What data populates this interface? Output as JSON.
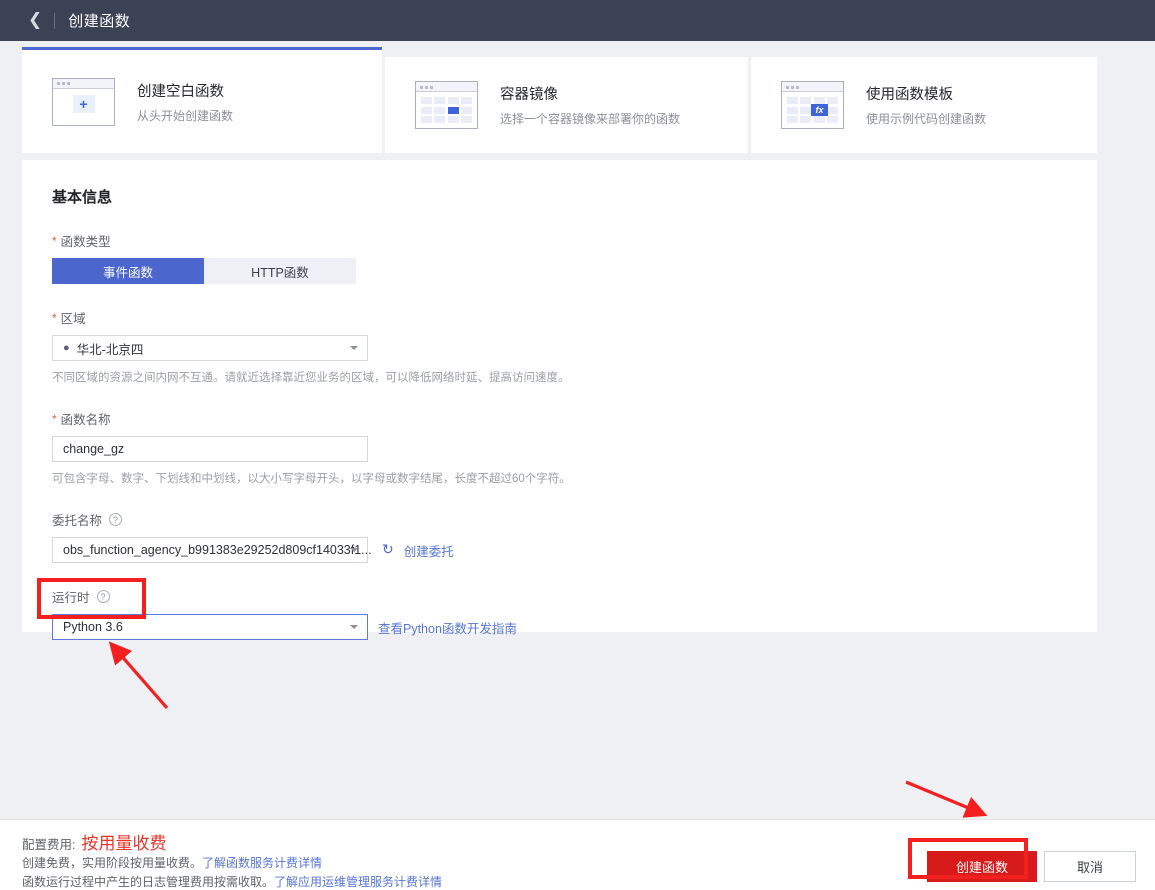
{
  "header": {
    "back_icon": "back-chevron-icon",
    "title": "创建函数"
  },
  "cards": [
    {
      "title": "创建空白函数",
      "subtitle": "从头开始创建函数",
      "icon": "blank-function-icon",
      "selected": true
    },
    {
      "title": "容器镜像",
      "subtitle": "选择一个容器镜像来部署你的函数",
      "icon": "container-image-icon",
      "selected": false
    },
    {
      "title": "使用函数模板",
      "subtitle": "使用示例代码创建函数",
      "icon": "function-template-fx-icon",
      "selected": false
    }
  ],
  "form": {
    "section_title": "基本信息",
    "function_type": {
      "label": "函数类型",
      "required_mark": "*",
      "options": [
        "事件函数",
        "HTTP函数"
      ],
      "selected": "事件函数"
    },
    "region": {
      "label": "区域",
      "required_mark": "*",
      "value": "华北-北京四",
      "icon": "location-pin-icon",
      "hint": "不同区域的资源之间内网不互通。请就近选择靠近您业务的区域，可以降低网络时延、提高访问速度。"
    },
    "function_name": {
      "label": "函数名称",
      "required_mark": "*",
      "value": "change_gz",
      "placeholder": "",
      "hint": "可包含字母、数字、下划线和中划线，以大小写字母开头，以字母或数字结尾，长度不超过60个字符。"
    },
    "agency": {
      "label": "委托名称",
      "help_icon": "question-mark-icon",
      "value": "obs_function_agency_b991383e29252d809cf14033f1...",
      "refresh_icon": "refresh-icon",
      "create_link": "创建委托"
    },
    "runtime": {
      "label": "运行时",
      "help_icon": "question-mark-icon",
      "value": "Python 3.6",
      "guide_link": "查看Python函数开发指南"
    }
  },
  "footer": {
    "fee_label": "配置费用:",
    "fee_value": "按用量收费",
    "line1_prefix": "创建免费，实用阶段按用量收费。",
    "line1_link": "了解函数服务计费详情",
    "line2_prefix": "函数运行过程中产生的日志管理费用按需收取。",
    "line2_link": "了解应用运维管理服务计费详情",
    "primary_button": "创建函数",
    "secondary_button": "取消"
  },
  "annotations": {
    "runtime_highlight": "red-box-runtime-select",
    "create_button_highlight": "red-box-create-button",
    "arrow_runtime": "red-arrow-pointing-to-runtime",
    "arrow_create": "red-arrow-pointing-to-create-button",
    "color": "#f41f1f"
  },
  "colors": {
    "topbar": "#3b4254",
    "accent_blue": "#4b66cc",
    "link_blue": "#5675d6",
    "primary_red": "#d71b1b",
    "annotation_red": "#f41f1f",
    "required_red": "#e8543f"
  }
}
